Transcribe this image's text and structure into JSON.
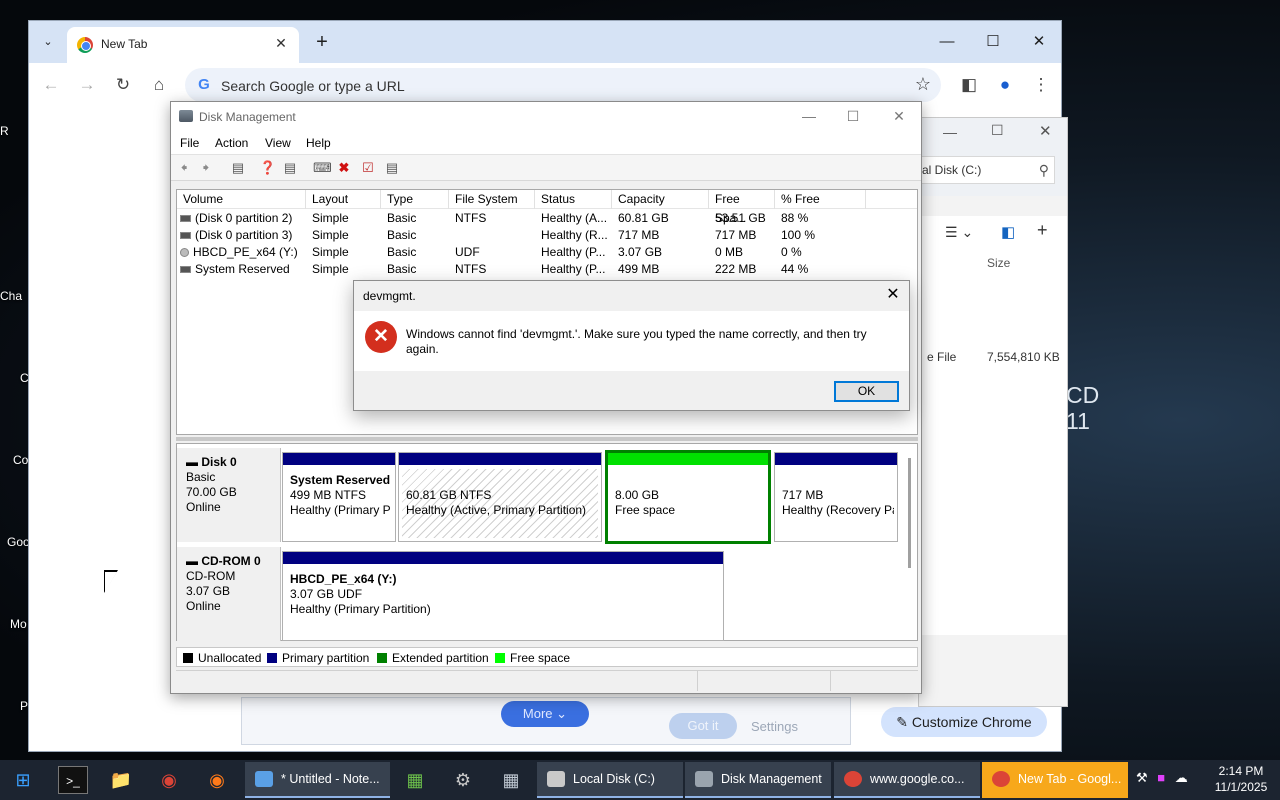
{
  "desktop": {
    "labels": [
      "R",
      "Cha",
      "C",
      "Co",
      "Goo",
      "Mo",
      "P"
    ],
    "hbcd_logo": [
      "CD",
      "11"
    ]
  },
  "chrome": {
    "tab_title": "New Tab",
    "omnibox_placeholder": "Search Google or type a URL",
    "more_label": "More",
    "gotit_label": "Got it",
    "settings_label": "Settings",
    "customize_label": "Customize Chrome"
  },
  "explorer": {
    "address": "al Disk (C:)",
    "size_header": "Size",
    "file_label": "e File",
    "file_size": "7,554,810 KB"
  },
  "disk_management": {
    "title": "Disk Management",
    "menu": [
      "File",
      "Action",
      "View",
      "Help"
    ],
    "columns": [
      "Volume",
      "Layout",
      "Type",
      "File System",
      "Status",
      "Capacity",
      "Free Spa...",
      "% Free"
    ],
    "volumes": [
      {
        "volume": "(Disk 0 partition 2)",
        "layout": "Simple",
        "type": "Basic",
        "fs": "NTFS",
        "status": "Healthy (A...",
        "capacity": "60.81 GB",
        "free": "53.51 GB",
        "pct": "88 %"
      },
      {
        "volume": "(Disk 0 partition 3)",
        "layout": "Simple",
        "type": "Basic",
        "fs": "",
        "status": "Healthy (R...",
        "capacity": "717 MB",
        "free": "717 MB",
        "pct": "100 %"
      },
      {
        "volume": "HBCD_PE_x64 (Y:)",
        "layout": "Simple",
        "type": "Basic",
        "fs": "UDF",
        "status": "Healthy (P...",
        "capacity": "3.07 GB",
        "free": "0 MB",
        "pct": "0 %"
      },
      {
        "volume": "System Reserved",
        "layout": "Simple",
        "type": "Basic",
        "fs": "NTFS",
        "status": "Healthy (P...",
        "capacity": "499 MB",
        "free": "222 MB",
        "pct": "44 %"
      }
    ],
    "disk0": {
      "name": "Disk 0",
      "kind": "Basic",
      "size": "70.00 GB",
      "state": "Online",
      "partitions": [
        {
          "name": "System Reserved",
          "line1": "499 MB NTFS",
          "line2": "Healthy (Primary P"
        },
        {
          "name": "",
          "line1": "60.81 GB NTFS",
          "line2": "Healthy (Active, Primary Partition)"
        },
        {
          "name": "",
          "line1": "8.00 GB",
          "line2": "Free space"
        },
        {
          "name": "",
          "line1": "717 MB",
          "line2": "Healthy (Recovery Pa"
        }
      ]
    },
    "cdrom0": {
      "name": "CD-ROM 0",
      "kind": "CD-ROM",
      "size": "3.07 GB",
      "state": "Online",
      "partition": {
        "name": "HBCD_PE_x64  (Y:)",
        "line1": "3.07 GB UDF",
        "line2": "Healthy (Primary Partition)"
      }
    },
    "legend": [
      {
        "label": "Unallocated",
        "color": "#000000"
      },
      {
        "label": "Primary partition",
        "color": "#000080"
      },
      {
        "label": "Extended partition",
        "color": "#008000"
      },
      {
        "label": "Free space",
        "color": "#00ff00"
      }
    ]
  },
  "dialog": {
    "title": "devmgmt.",
    "message": "Windows cannot find 'devmgmt.'. Make sure you typed the name correctly, and then try again.",
    "ok_label": "OK"
  },
  "taskbar": {
    "tasks": [
      {
        "label": "* Untitled - Note...",
        "color": "#5aa0e6"
      },
      {
        "label": "Local Disk (C:)",
        "color": "#c9c9c9"
      },
      {
        "label": "Disk Management",
        "color": "#9aa4ae"
      },
      {
        "label": "www.google.co...",
        "color": "#db4437"
      },
      {
        "label": "New Tab - Googl...",
        "color": "#db4437"
      }
    ],
    "time": "2:14 PM",
    "date": "11/1/2025"
  }
}
